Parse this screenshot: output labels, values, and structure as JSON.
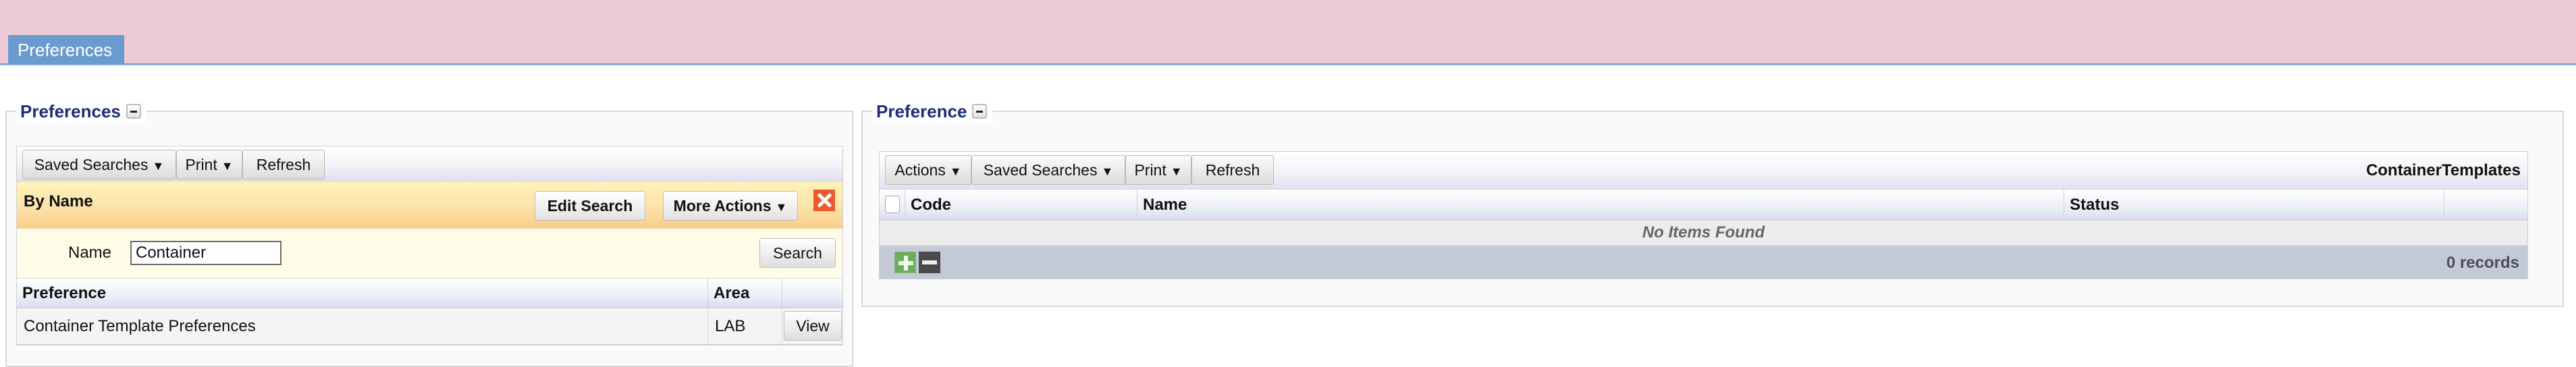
{
  "header": {
    "tab_label": "Preferences"
  },
  "left_panel": {
    "legend": "Preferences",
    "toolbar": {
      "saved_searches": "Saved Searches",
      "print": "Print",
      "refresh": "Refresh",
      "dropdown_arrow": "▼"
    },
    "search_band": {
      "title": "By Name",
      "edit_search": "Edit Search",
      "more_actions": "More Actions",
      "close_icon": "close-icon"
    },
    "search_form": {
      "name_label": "Name",
      "name_value": "Container",
      "search_button": "Search"
    },
    "table": {
      "columns": [
        "Preference",
        "Area",
        ""
      ],
      "rows": [
        {
          "preference": "Container Template Preferences",
          "area": "LAB",
          "action": "View"
        }
      ]
    }
  },
  "right_panel": {
    "legend": "Preference",
    "toolbar": {
      "actions": "Actions",
      "saved_searches": "Saved Searches",
      "print": "Print",
      "refresh": "Refresh",
      "dropdown_arrow": "▼",
      "title": "ContainerTemplates"
    },
    "table": {
      "columns": [
        "Code",
        "Name",
        "Status",
        ""
      ],
      "empty_message": "No Items Found"
    },
    "footer": {
      "add_icon": "plus-icon",
      "remove_icon": "minus-icon",
      "records": "0 records"
    }
  },
  "colors": {
    "header_band": "#ebcbd6",
    "tab": "#6a9bcf",
    "legend": "#1d2c7c",
    "close": "#ee5a2c",
    "add": "#6aae5b"
  }
}
